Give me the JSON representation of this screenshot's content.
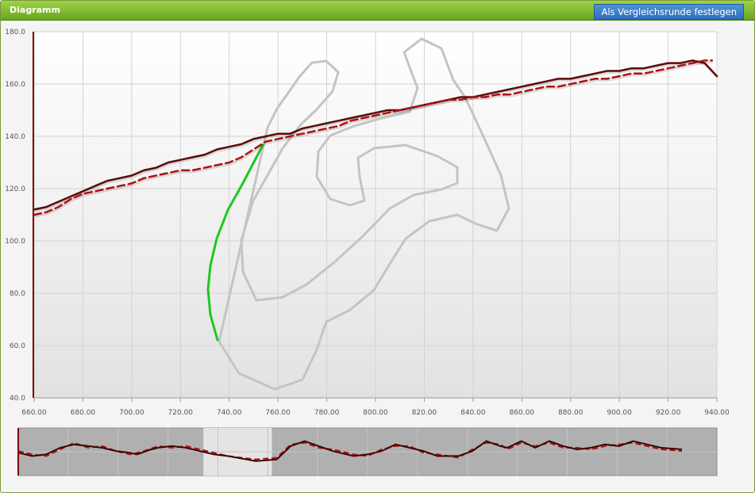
{
  "panel": {
    "title": "Diagramm",
    "compare_button_label": "Als Vergleichsrunde festlegen"
  },
  "colors": {
    "header_green": "#7cb82f",
    "button_blue": "#3d80cd",
    "speed_solid": "#5c0a0a",
    "speed_dashed": "#b01010",
    "track_outline": "#c4c4c4",
    "track_highlight": "#1ec81e"
  },
  "chart_data": {
    "type": "line",
    "title": "",
    "xlabel": "",
    "ylabel": "",
    "xlim": [
      660,
      940
    ],
    "ylim": [
      40,
      180
    ],
    "x_ticks": [
      "660.00",
      "680.00",
      "700.00",
      "720.00",
      "740.00",
      "760.00",
      "780.00",
      "800.00",
      "820.00",
      "840.00",
      "860.00",
      "880.00",
      "900.00",
      "920.00",
      "940.00"
    ],
    "y_ticks": [
      "40.0",
      "60.0",
      "80.0",
      "100.0",
      "120.0",
      "140.0",
      "160.0",
      "180.0"
    ],
    "grid": true,
    "series": [
      {
        "style": "solid",
        "color": "#5c0a0a",
        "x": [
          660,
          665,
          670,
          675,
          680,
          685,
          690,
          695,
          700,
          705,
          710,
          715,
          720,
          725,
          730,
          735,
          740,
          745,
          750,
          755,
          760,
          765,
          770,
          775,
          780,
          785,
          790,
          795,
          800,
          805,
          810,
          815,
          820,
          825,
          830,
          835,
          840,
          845,
          850,
          855,
          860,
          865,
          870,
          875,
          880,
          885,
          890,
          895,
          900,
          905,
          910,
          915,
          920,
          925,
          930,
          935,
          940
        ],
        "y": [
          112,
          113,
          115,
          117,
          119,
          121,
          123,
          124,
          125,
          127,
          128,
          130,
          131,
          132,
          133,
          135,
          136,
          137,
          139,
          140,
          141,
          141,
          143,
          144,
          145,
          146,
          147,
          148,
          149,
          150,
          150,
          151,
          152,
          153,
          154,
          155,
          155,
          156,
          157,
          158,
          159,
          160,
          161,
          162,
          162,
          163,
          164,
          165,
          165,
          166,
          166,
          167,
          168,
          168,
          169,
          168,
          163
        ]
      },
      {
        "style": "dashed",
        "color": "#b01010",
        "x": [
          660,
          665,
          670,
          675,
          680,
          685,
          690,
          695,
          700,
          705,
          710,
          715,
          720,
          725,
          730,
          735,
          740,
          745,
          750,
          755,
          760,
          765,
          770,
          775,
          780,
          785,
          790,
          795,
          800,
          805,
          810,
          815,
          820,
          825,
          830,
          835,
          840,
          845,
          850,
          855,
          860,
          865,
          870,
          875,
          880,
          885,
          890,
          895,
          900,
          905,
          910,
          915,
          920,
          925,
          930,
          935,
          938
        ],
        "y": [
          110,
          111,
          113,
          116,
          118,
          119,
          120,
          121,
          122,
          124,
          125,
          126,
          127,
          127,
          128,
          129,
          130,
          132,
          135,
          138,
          139,
          140,
          141,
          142,
          143,
          144,
          146,
          147,
          148,
          149,
          150,
          151,
          152,
          153,
          154,
          154,
          155,
          155,
          156,
          156,
          157,
          158,
          159,
          159,
          160,
          161,
          162,
          162,
          163,
          164,
          164,
          165,
          166,
          167,
          168,
          169,
          169
        ]
      }
    ],
    "track_map": {
      "outline_color": "#c4c4c4",
      "highlight_color": "#1ec81e",
      "outline": [
        [
          275,
          430
        ],
        [
          300,
          470
        ],
        [
          345,
          490
        ],
        [
          380,
          478
        ],
        [
          398,
          440
        ],
        [
          410,
          405
        ],
        [
          440,
          390
        ],
        [
          470,
          365
        ],
        [
          490,
          332
        ],
        [
          510,
          300
        ],
        [
          540,
          278
        ],
        [
          575,
          270
        ],
        [
          600,
          282
        ],
        [
          625,
          290
        ],
        [
          640,
          262
        ],
        [
          630,
          220
        ],
        [
          605,
          165
        ],
        [
          585,
          122
        ],
        [
          570,
          100
        ],
        [
          555,
          60
        ],
        [
          530,
          48
        ],
        [
          508,
          65
        ],
        [
          518,
          92
        ],
        [
          525,
          110
        ],
        [
          515,
          140
        ],
        [
          480,
          148
        ],
        [
          445,
          158
        ],
        [
          415,
          170
        ],
        [
          400,
          190
        ],
        [
          398,
          222
        ],
        [
          415,
          250
        ],
        [
          440,
          258
        ],
        [
          458,
          252
        ],
        [
          452,
          222
        ],
        [
          450,
          198
        ],
        [
          470,
          186
        ],
        [
          510,
          182
        ],
        [
          550,
          196
        ],
        [
          575,
          210
        ],
        [
          575,
          230
        ],
        [
          555,
          238
        ],
        [
          520,
          245
        ],
        [
          490,
          262
        ],
        [
          455,
          298
        ],
        [
          420,
          330
        ],
        [
          385,
          358
        ],
        [
          355,
          374
        ],
        [
          322,
          378
        ],
        [
          305,
          342
        ],
        [
          303,
          302
        ],
        [
          318,
          252
        ],
        [
          336,
          220
        ],
        [
          355,
          186
        ],
        [
          378,
          156
        ],
        [
          398,
          137
        ],
        [
          418,
          114
        ],
        [
          425,
          90
        ],
        [
          410,
          76
        ],
        [
          392,
          78
        ],
        [
          376,
          96
        ],
        [
          365,
          112
        ],
        [
          348,
          136
        ],
        [
          336,
          160
        ]
      ],
      "highlight": [
        [
          330,
          182
        ],
        [
          305,
          230
        ],
        [
          286,
          264
        ],
        [
          272,
          300
        ],
        [
          264,
          334
        ],
        [
          261,
          364
        ],
        [
          264,
          396
        ],
        [
          273,
          428
        ]
      ]
    },
    "overview": {
      "selection": [
        0.265,
        0.363
      ],
      "solid": [
        [
          0,
          0.4
        ],
        [
          0.02,
          0.3
        ],
        [
          0.04,
          0.35
        ],
        [
          0.06,
          0.55
        ],
        [
          0.08,
          0.65
        ],
        [
          0.1,
          0.6
        ],
        [
          0.12,
          0.55
        ],
        [
          0.14,
          0.45
        ],
        [
          0.16,
          0.4
        ],
        [
          0.17,
          0.35
        ],
        [
          0.19,
          0.5
        ],
        [
          0.2,
          0.55
        ],
        [
          0.22,
          0.6
        ],
        [
          0.24,
          0.55
        ],
        [
          0.26,
          0.45
        ],
        [
          0.28,
          0.35
        ],
        [
          0.3,
          0.3
        ],
        [
          0.34,
          0.15
        ],
        [
          0.37,
          0.2
        ],
        [
          0.39,
          0.6
        ],
        [
          0.41,
          0.75
        ],
        [
          0.43,
          0.6
        ],
        [
          0.45,
          0.45
        ],
        [
          0.48,
          0.3
        ],
        [
          0.5,
          0.35
        ],
        [
          0.52,
          0.45
        ],
        [
          0.54,
          0.65
        ],
        [
          0.56,
          0.55
        ],
        [
          0.58,
          0.45
        ],
        [
          0.6,
          0.3
        ],
        [
          0.63,
          0.3
        ],
        [
          0.65,
          0.45
        ],
        [
          0.67,
          0.75
        ],
        [
          0.69,
          0.6
        ],
        [
          0.7,
          0.55
        ],
        [
          0.72,
          0.75
        ],
        [
          0.74,
          0.55
        ],
        [
          0.76,
          0.75
        ],
        [
          0.78,
          0.6
        ],
        [
          0.8,
          0.5
        ],
        [
          0.82,
          0.55
        ],
        [
          0.84,
          0.65
        ],
        [
          0.86,
          0.6
        ],
        [
          0.88,
          0.75
        ],
        [
          0.9,
          0.65
        ],
        [
          0.92,
          0.55
        ],
        [
          0.95,
          0.5
        ]
      ],
      "dashed": [
        [
          0,
          0.45
        ],
        [
          0.02,
          0.35
        ],
        [
          0.04,
          0.3
        ],
        [
          0.06,
          0.5
        ],
        [
          0.08,
          0.7
        ],
        [
          0.1,
          0.55
        ],
        [
          0.12,
          0.6
        ],
        [
          0.14,
          0.45
        ],
        [
          0.16,
          0.35
        ],
        [
          0.18,
          0.45
        ],
        [
          0.2,
          0.6
        ],
        [
          0.22,
          0.55
        ],
        [
          0.24,
          0.6
        ],
        [
          0.26,
          0.5
        ],
        [
          0.28,
          0.4
        ],
        [
          0.3,
          0.3
        ],
        [
          0.34,
          0.2
        ],
        [
          0.37,
          0.25
        ],
        [
          0.39,
          0.65
        ],
        [
          0.41,
          0.7
        ],
        [
          0.43,
          0.55
        ],
        [
          0.45,
          0.5
        ],
        [
          0.48,
          0.35
        ],
        [
          0.5,
          0.3
        ],
        [
          0.52,
          0.5
        ],
        [
          0.54,
          0.6
        ],
        [
          0.56,
          0.6
        ],
        [
          0.58,
          0.4
        ],
        [
          0.6,
          0.35
        ],
        [
          0.63,
          0.25
        ],
        [
          0.65,
          0.5
        ],
        [
          0.67,
          0.7
        ],
        [
          0.69,
          0.65
        ],
        [
          0.7,
          0.5
        ],
        [
          0.72,
          0.7
        ],
        [
          0.74,
          0.6
        ],
        [
          0.76,
          0.7
        ],
        [
          0.78,
          0.55
        ],
        [
          0.8,
          0.55
        ],
        [
          0.82,
          0.5
        ],
        [
          0.84,
          0.6
        ],
        [
          0.86,
          0.65
        ],
        [
          0.88,
          0.7
        ],
        [
          0.9,
          0.6
        ],
        [
          0.92,
          0.5
        ],
        [
          0.95,
          0.45
        ]
      ]
    }
  }
}
